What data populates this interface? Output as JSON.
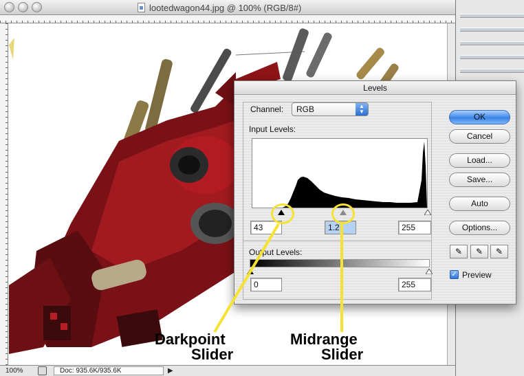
{
  "document": {
    "title": "lootedwagon44.jpg @ 100% (RGB/8#)",
    "zoom": "100%",
    "doc_size": "Doc: 935.6K/935.6K"
  },
  "levels_dialog": {
    "title": "Levels",
    "channel_label": "Channel:",
    "channel_value": "RGB",
    "input_levels_label": "Input Levels:",
    "input_black": "43",
    "input_mid": "1.2",
    "input_white": "255",
    "input_black_fraction": 0.169,
    "input_mid_fraction": 0.52,
    "output_levels_label": "Output Levels:",
    "output_black": "0",
    "output_white": "255",
    "buttons": {
      "ok": "OK",
      "cancel": "Cancel",
      "load": "Load...",
      "save": "Save...",
      "auto": "Auto",
      "options": "Options..."
    },
    "preview_label": "Preview",
    "preview_checked": true
  },
  "annotations": {
    "darkpoint_line1": "Darkpoint",
    "darkpoint_line2": "Slider",
    "midrange_line1": "Midrange",
    "midrange_line2": "Slider",
    "color": "#f5e232"
  }
}
